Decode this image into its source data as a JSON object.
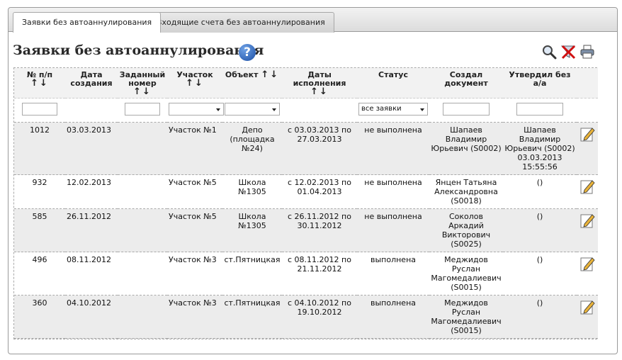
{
  "tabs": [
    {
      "label": "Заявки без автоаннулирования",
      "active": true
    },
    {
      "label": "Входящие счета без автоаннулирования",
      "active": false
    }
  ],
  "page_title": "Заявки без автоаннулирования",
  "help_symbol": "?",
  "toolbar": {
    "search_icon": "search-icon",
    "clear_icon": "clear-filter-icon",
    "print_icon": "print-icon"
  },
  "columns": [
    {
      "label": "№ п/п",
      "sortable": true
    },
    {
      "label": "Дата создания",
      "sortable": false
    },
    {
      "label": "Заданный номер",
      "sortable": true
    },
    {
      "label": "Участок",
      "sortable": true
    },
    {
      "label": "Объект",
      "sortable": true
    },
    {
      "label": "Даты исполнения",
      "sortable": true
    },
    {
      "label": "Статус",
      "sortable": false
    },
    {
      "label": "Создал документ",
      "sortable": false
    },
    {
      "label": "Утвердил без а/а",
      "sortable": false
    }
  ],
  "sort_arrows": "↑↓",
  "filters": {
    "status_selected": "все заявки"
  },
  "rows": [
    {
      "num": "1012",
      "date": "03.03.2013",
      "given": "",
      "site": "Участок №1",
      "object": "Депо (площадка №24)",
      "dates": "с 03.03.2013 по 27.03.2013",
      "status": "не выполнена",
      "creator": "Шапаев Владимир Юрьевич (S0002)",
      "approver": "Шапаев Владимир Юрьевич (S0002) 03.03.2013 15:55:56"
    },
    {
      "num": "932",
      "date": "12.02.2013",
      "given": "",
      "site": "Участок №5",
      "object": "Школа №1305",
      "dates": "с 12.02.2013 по 01.04.2013",
      "status": "не выполнена",
      "creator": "Янцен Татьяна Александровна (S0018)",
      "approver": "()"
    },
    {
      "num": "585",
      "date": "26.11.2012",
      "given": "",
      "site": "Участок №5",
      "object": "Школа №1305",
      "dates": "с 26.11.2012 по 30.11.2012",
      "status": "не выполнена",
      "creator": "Соколов Аркадий Викторович (S0025)",
      "approver": "()"
    },
    {
      "num": "496",
      "date": "08.11.2012",
      "given": "",
      "site": "Участок №3",
      "object": "ст.Пятницкая",
      "dates": "с 08.11.2012 по 21.11.2012",
      "status": "выполнена",
      "creator": "Меджидов Руслан Магомедалиевич (S0015)",
      "approver": "()"
    },
    {
      "num": "360",
      "date": "04.10.2012",
      "given": "",
      "site": "Участок №3",
      "object": "ст.Пятницкая",
      "dates": "с 04.10.2012 по 19.10.2012",
      "status": "выполнена",
      "creator": "Меджидов Руслан Магомедалиевич (S0015)",
      "approver": "()"
    }
  ]
}
